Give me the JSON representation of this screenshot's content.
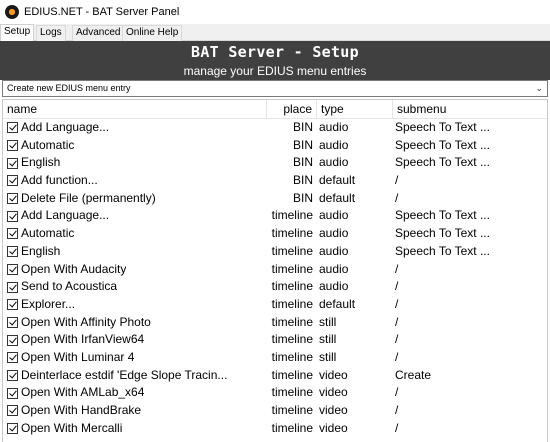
{
  "window": {
    "title": "EDIUS.NET - BAT Server Panel"
  },
  "tabs": [
    {
      "label": "Setup"
    },
    {
      "label": "Logs"
    },
    {
      "label": "Advanced"
    },
    {
      "label": "Online Help"
    }
  ],
  "header": {
    "title": "BAT Server - Setup",
    "subtitle": "manage your EDIUS menu entries"
  },
  "dropdown": {
    "selected": "Create new EDIUS menu entry"
  },
  "columns": {
    "name": "name",
    "place": "place",
    "type": "type",
    "submenu": "submenu"
  },
  "rows": [
    {
      "checked": true,
      "name": "Add Language...",
      "place": "BIN",
      "type": "audio",
      "submenu": "Speech To Text ..."
    },
    {
      "checked": true,
      "name": "Automatic",
      "place": "BIN",
      "type": "audio",
      "submenu": "Speech To Text ..."
    },
    {
      "checked": true,
      "name": "English",
      "place": "BIN",
      "type": "audio",
      "submenu": "Speech To Text ..."
    },
    {
      "checked": true,
      "name": "Add function...",
      "place": "BIN",
      "type": "default",
      "submenu": "/"
    },
    {
      "checked": true,
      "name": "Delete File (permanently)",
      "place": "BIN",
      "type": "default",
      "submenu": "/"
    },
    {
      "checked": true,
      "name": "Add Language...",
      "place": "timeline",
      "type": "audio",
      "submenu": "Speech To Text ..."
    },
    {
      "checked": true,
      "name": "Automatic",
      "place": "timeline",
      "type": "audio",
      "submenu": "Speech To Text ..."
    },
    {
      "checked": true,
      "name": "English",
      "place": "timeline",
      "type": "audio",
      "submenu": "Speech To Text ..."
    },
    {
      "checked": true,
      "name": "Open With Audacity",
      "place": "timeline",
      "type": "audio",
      "submenu": "/"
    },
    {
      "checked": true,
      "name": "Send to Acoustica",
      "place": "timeline",
      "type": "audio",
      "submenu": "/"
    },
    {
      "checked": true,
      "name": "Explorer...",
      "place": "timeline",
      "type": "default",
      "submenu": "/"
    },
    {
      "checked": true,
      "name": "Open With Affinity Photo",
      "place": "timeline",
      "type": "still",
      "submenu": "/"
    },
    {
      "checked": true,
      "name": "Open With IrfanView64",
      "place": "timeline",
      "type": "still",
      "submenu": "/"
    },
    {
      "checked": true,
      "name": "Open With Luminar 4",
      "place": "timeline",
      "type": "still",
      "submenu": "/"
    },
    {
      "checked": true,
      "name": "Deinterlace estdif 'Edge Slope Tracin...",
      "place": "timeline",
      "type": "video",
      "submenu": "Create"
    },
    {
      "checked": true,
      "name": "Open With AMLab_x64",
      "place": "timeline",
      "type": "video",
      "submenu": "/"
    },
    {
      "checked": true,
      "name": "Open With HandBrake",
      "place": "timeline",
      "type": "video",
      "submenu": "/"
    },
    {
      "checked": true,
      "name": "Open With Mercalli",
      "place": "timeline",
      "type": "video",
      "submenu": "/"
    }
  ]
}
